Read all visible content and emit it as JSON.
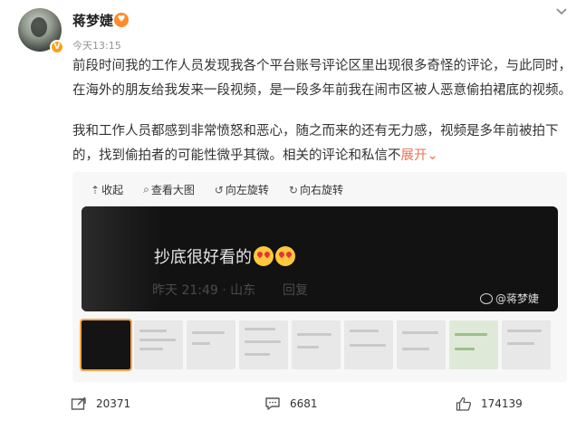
{
  "user": {
    "name": "蒋梦婕",
    "timestamp": "今天13:15",
    "verified_badge": "V",
    "vip_icon": "heart-eyes-icon"
  },
  "post": {
    "paragraph1_line1": "前段时间我的工作人员发现我各个平台账号评论区里出现很多奇怪的评论，与此同时，",
    "paragraph1_line2": "在海外的朋友给我发来一段视频，是一段多年前我在闹市区被人恶意偷拍裙底的视频。",
    "paragraph2_line1": "我和工作人员都感到非常愤怒和恶心，随之而来的还有无力感，视频是多年前被拍下",
    "paragraph2_line2": "的，找到偷拍者的可能性微乎其微。相关的评论和私信不",
    "expand_label": "展开"
  },
  "toolbar": {
    "collapse": "收起",
    "view_large": "查看大图",
    "rotate_left": "向左旋转",
    "rotate_right": "向右旋转"
  },
  "image": {
    "comment_text": "抄底很好看的",
    "comment_meta": "昨天 21:49 · 山东",
    "reply": "回复",
    "watermark": "@蒋梦婕"
  },
  "thumbnails_count": 9,
  "actions": {
    "repost_count": "20371",
    "comment_count": "6681",
    "like_count": "174139"
  },
  "colors": {
    "accent": "#eb7350",
    "badge": "#f7a21b"
  }
}
